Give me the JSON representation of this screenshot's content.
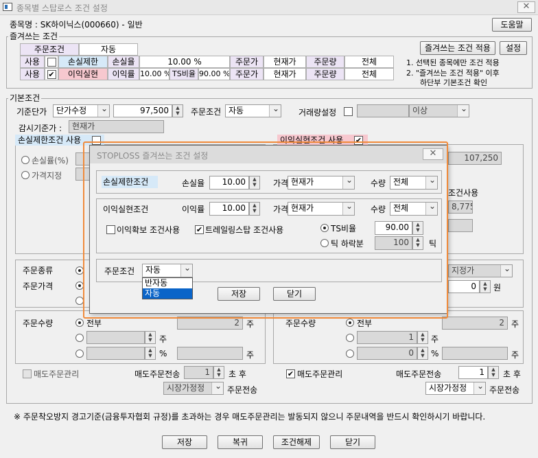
{
  "window": {
    "title": "종목별 스탑로스 조건 설정"
  },
  "header": {
    "stock_label": "종목명 : SK하이닉스(000660) - 일반",
    "help_button": "도움말"
  },
  "favorites": {
    "group_label": "즐겨쓰는 조건",
    "order_cond_header": "주문조건",
    "order_cond_value": "자동",
    "rows": [
      {
        "use": "사용",
        "checked": "",
        "type": "손실제한",
        "rate_label": "손실율",
        "rate_value": "10.00 %",
        "extra_label": "",
        "extra_value": "",
        "price_label": "주문가",
        "price_value": "현재가",
        "qty_label": "주문량",
        "qty_value": "전체"
      },
      {
        "use": "사용",
        "checked": "✔",
        "type": "이익실현",
        "rate_label": "이익률",
        "rate_value": "10.00 %",
        "extra_label": "TS비율",
        "extra_value": "90.00 %",
        "price_label": "주문가",
        "price_value": "현재가",
        "qty_label": "주문량",
        "qty_value": "전체"
      }
    ],
    "apply_button": "즐겨쓰는 조건 적용",
    "settings_button": "설정",
    "note1": "1. 선택된 종목에만 조건 적용",
    "note2": "2. \"즐겨쓰는 조건 적용\" 이후",
    "note3": "하단부 기본조건 확인"
  },
  "basic": {
    "group_label": "기본조건",
    "base_price_label": "기준단가",
    "base_price_select": "단가수정",
    "base_price_value": "97,500",
    "order_cond_label": "주문조건",
    "order_cond_select": "자동",
    "volume_label": "거래량설정",
    "volume_value": "",
    "volume_select": "이상",
    "monitor_label": "감시기준가 :",
    "monitor_value": "현재가",
    "loss_use_label": "손실제한조건 사용",
    "profit_use_label": "이익실현조건 사용",
    "loss_rate_radio": "손실률(%)",
    "price_set_radio": "가격지정",
    "right_value": "107,250",
    "right_cond_use": "조건사용",
    "right_value2": "8,775"
  },
  "order_left": {
    "type_label": "주문종류",
    "price_label": "주문가격",
    "qty_label": "주문수량",
    "all_label": "전부",
    "qty_value": "2",
    "unit_ju": "주",
    "unit_pct": "%",
    "sell_label": "매도주문관리",
    "sell_count_label": "매도주문전송",
    "sell_count_value": "1",
    "after_label": "초 후",
    "market_select": "시장가정정",
    "send_label": "주문전송"
  },
  "order_right": {
    "price_type": "지정가",
    "price_value": "0",
    "won": "원",
    "qty_label": "주문수량",
    "all_label": "전부",
    "qty_value": "2",
    "qty_value2": "1",
    "qty_value3": "0",
    "unit_ju": "주",
    "unit_pct": "%",
    "sell_label": "매도주문관리",
    "sell_count_label": "매도주문전송",
    "sell_count_value": "1",
    "after_label": "초 후",
    "market_select": "시장가정정",
    "send_label": "주문전송"
  },
  "footer": {
    "notice": "※ 주문착오방지 경고기준(금융투자협회 규정)를 초과하는 경우 매도주문관리는 발동되지 않으니 주문내역을 반드시 확인하시기 바랍니다.",
    "save": "저장",
    "restore": "복귀",
    "remove": "조건해제",
    "close": "닫기"
  },
  "dialog": {
    "title": "STOPLOSS 즐겨쓰는 조건 설정",
    "loss_label": "손실제한조건",
    "loss_rate_label": "손실율",
    "loss_rate_value": "10.00",
    "price_label": "가격",
    "loss_price_select": "현재가",
    "qty_label": "수량",
    "loss_qty_select": "전체",
    "profit_label": "이익실현조건",
    "profit_rate_label": "이익률",
    "profit_rate_value": "10.00",
    "profit_price_select": "현재가",
    "profit_qty_select": "전체",
    "profit_lock_label": "이익확보 조건사용",
    "trailing_label": "트레일링스탑 조건사용",
    "ts_ratio_label": "TS비율",
    "ts_ratio_value": "90.00",
    "tick_drop_label": "틱 하락분",
    "tick_value": "100",
    "tick_unit": "틱",
    "order_cond_label": "주문조건",
    "order_cond_select": "자동",
    "options": [
      "반자동",
      "자동"
    ],
    "save": "저장",
    "close": "닫기"
  }
}
